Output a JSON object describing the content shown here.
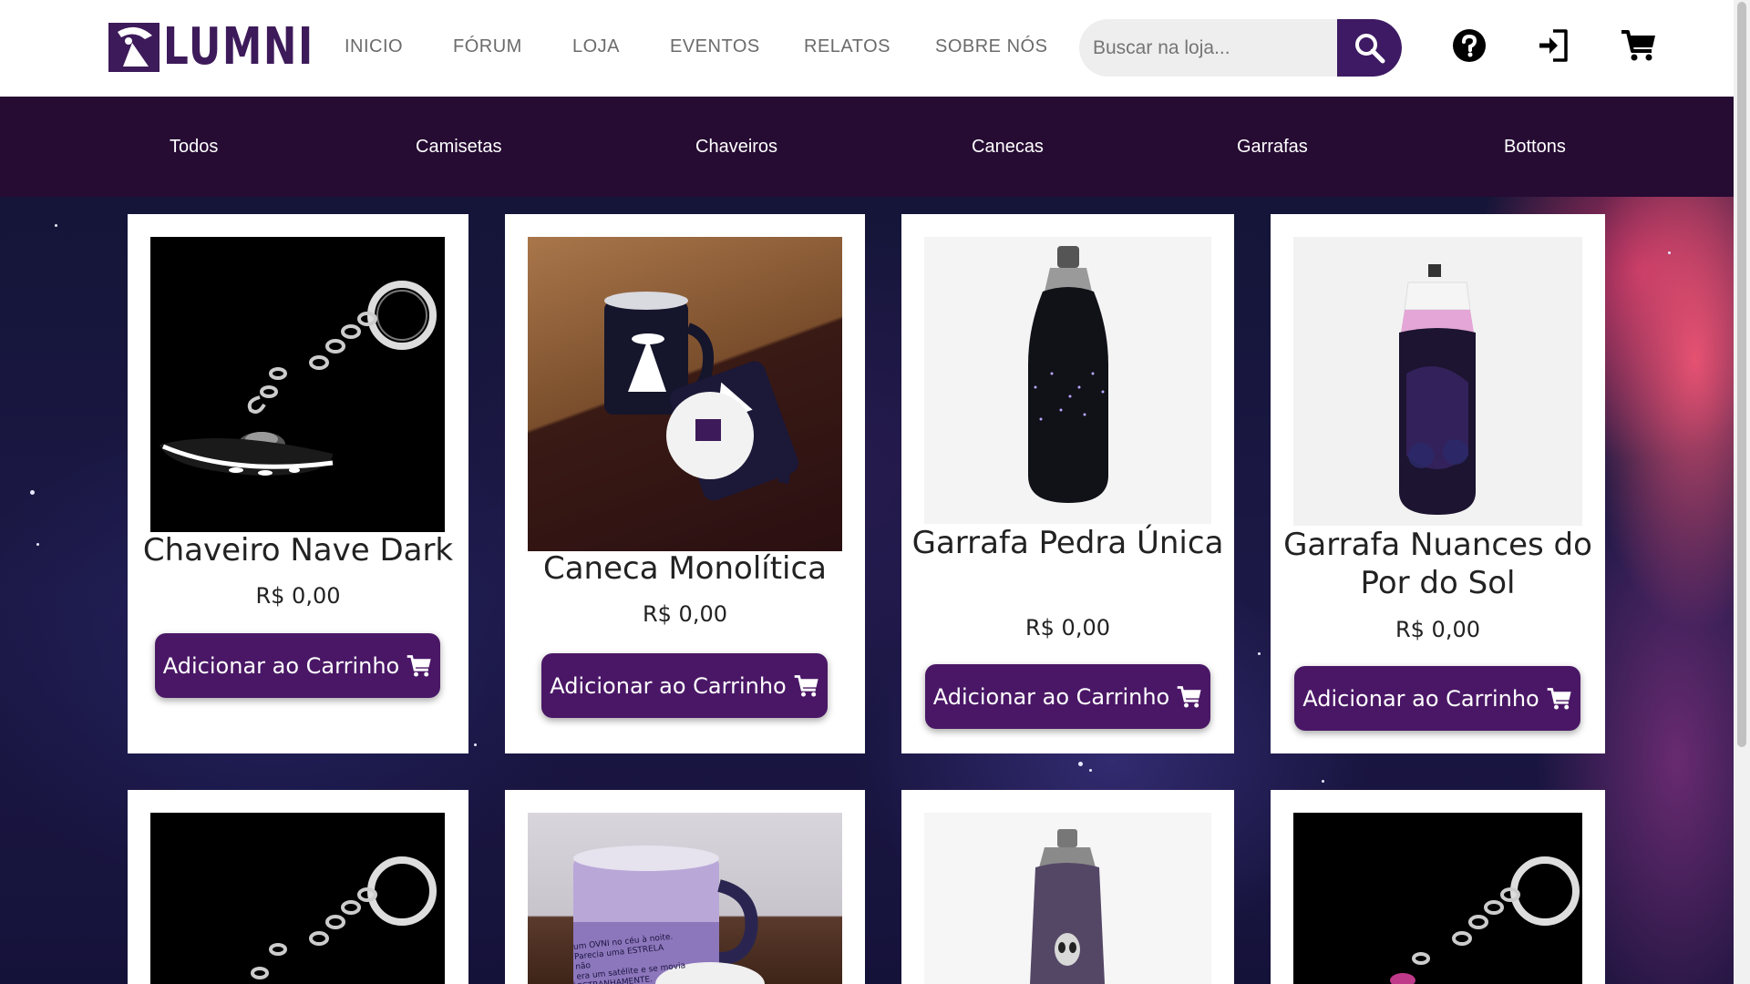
{
  "brand": {
    "name": "LUMNI"
  },
  "nav": {
    "items": [
      "INICIO",
      "FÓRUM",
      "LOJA",
      "EVENTOS",
      "RELATOS",
      "SOBRE NÓS"
    ]
  },
  "search": {
    "placeholder": "Buscar na loja...",
    "icon": "search-icon"
  },
  "header_icons": [
    "help-icon",
    "login-icon",
    "cart-icon"
  ],
  "categories": [
    "Todos",
    "Camisetas",
    "Chaveiros",
    "Canecas",
    "Garrafas",
    "Bottons"
  ],
  "products": [
    {
      "name": "Chaveiro Nave Dark",
      "price": "R$ 0,00",
      "button": "Adicionar ao Carrinho",
      "image": "ufo-keychain-dark"
    },
    {
      "name": "Caneca Monolítica",
      "price": "R$ 0,00",
      "button": "Adicionar ao Carrinho",
      "image": "ufo-mugs"
    },
    {
      "name": "Garrafa Pedra Única",
      "price": "R$ 0,00",
      "button": "Adicionar ao Carrinho",
      "image": "dark-starry-bottle"
    },
    {
      "name": "Garrafa Nuances do Por do Sol",
      "price": "R$ 0,00",
      "button": "Adicionar ao Carrinho",
      "image": "purple-galaxy-bottle"
    }
  ],
  "products_row2_images": [
    "ufo-keychain-dark",
    "galaxy-mug",
    "alien-bottle",
    "ufo-keychain-pink"
  ],
  "mug_print_text": [
    "um OVNI no céu à noite.",
    "Parecia uma ESTRELA",
    "não",
    "era um satélite e se movia",
    "ESTRANHAMENTE."
  ],
  "colors": {
    "brand_purple": "#3d1a63",
    "button_purple": "#4a1766",
    "category_bar": "#260b33",
    "nav_text": "#6b6b6b"
  }
}
